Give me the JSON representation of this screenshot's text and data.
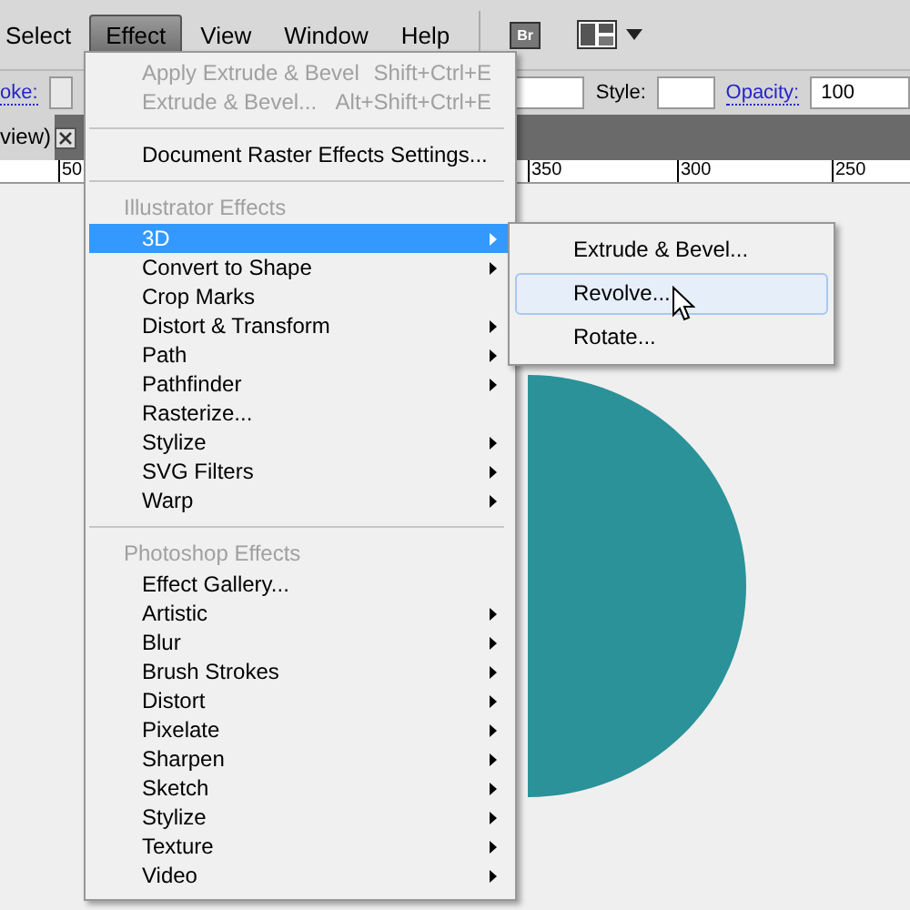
{
  "menubar": {
    "items": [
      {
        "label": "Select",
        "selected": false
      },
      {
        "label": "Effect",
        "selected": true
      },
      {
        "label": "View",
        "selected": false
      },
      {
        "label": "Window",
        "selected": false
      },
      {
        "label": "Help",
        "selected": false
      }
    ],
    "bridge_label": "Br"
  },
  "control_bar": {
    "stroke_label": "oke:",
    "style_label": "Style:",
    "opacity_label": "Opacity:",
    "opacity_value": "100"
  },
  "document_tab": {
    "title": "view)"
  },
  "ruler": {
    "labels": [
      "50",
      "350",
      "300",
      "250"
    ]
  },
  "menu": {
    "items": [
      {
        "kind": "item",
        "label": "Apply Extrude & Bevel",
        "shortcut": "Shift+Ctrl+E",
        "disabled": true,
        "submenu": false,
        "selected": false
      },
      {
        "kind": "item",
        "label": "Extrude & Bevel...",
        "shortcut": "Alt+Shift+Ctrl+E",
        "disabled": true,
        "submenu": false,
        "selected": false
      },
      {
        "kind": "separator"
      },
      {
        "kind": "item",
        "label": "Document Raster Effects Settings...",
        "disabled": false,
        "submenu": false,
        "selected": false
      },
      {
        "kind": "separator"
      },
      {
        "kind": "header",
        "label": "Illustrator Effects"
      },
      {
        "kind": "item",
        "label": "3D",
        "disabled": false,
        "submenu": true,
        "selected": true
      },
      {
        "kind": "item",
        "label": "Convert to Shape",
        "disabled": false,
        "submenu": true,
        "selected": false
      },
      {
        "kind": "item",
        "label": "Crop Marks",
        "disabled": false,
        "submenu": false,
        "selected": false
      },
      {
        "kind": "item",
        "label": "Distort & Transform",
        "disabled": false,
        "submenu": true,
        "selected": false
      },
      {
        "kind": "item",
        "label": "Path",
        "disabled": false,
        "submenu": true,
        "selected": false
      },
      {
        "kind": "item",
        "label": "Pathfinder",
        "disabled": false,
        "submenu": true,
        "selected": false
      },
      {
        "kind": "item",
        "label": "Rasterize...",
        "disabled": false,
        "submenu": false,
        "selected": false
      },
      {
        "kind": "item",
        "label": "Stylize",
        "disabled": false,
        "submenu": true,
        "selected": false
      },
      {
        "kind": "item",
        "label": "SVG Filters",
        "disabled": false,
        "submenu": true,
        "selected": false
      },
      {
        "kind": "item",
        "label": "Warp",
        "disabled": false,
        "submenu": true,
        "selected": false
      },
      {
        "kind": "separator"
      },
      {
        "kind": "header",
        "label": "Photoshop Effects"
      },
      {
        "kind": "item",
        "label": "Effect Gallery...",
        "disabled": false,
        "submenu": false,
        "selected": false
      },
      {
        "kind": "item",
        "label": "Artistic",
        "disabled": false,
        "submenu": true,
        "selected": false
      },
      {
        "kind": "item",
        "label": "Blur",
        "disabled": false,
        "submenu": true,
        "selected": false
      },
      {
        "kind": "item",
        "label": "Brush Strokes",
        "disabled": false,
        "submenu": true,
        "selected": false
      },
      {
        "kind": "item",
        "label": "Distort",
        "disabled": false,
        "submenu": true,
        "selected": false
      },
      {
        "kind": "item",
        "label": "Pixelate",
        "disabled": false,
        "submenu": true,
        "selected": false
      },
      {
        "kind": "item",
        "label": "Sharpen",
        "disabled": false,
        "submenu": true,
        "selected": false
      },
      {
        "kind": "item",
        "label": "Sketch",
        "disabled": false,
        "submenu": true,
        "selected": false
      },
      {
        "kind": "item",
        "label": "Stylize",
        "disabled": false,
        "submenu": true,
        "selected": false
      },
      {
        "kind": "item",
        "label": "Texture",
        "disabled": false,
        "submenu": true,
        "selected": false
      },
      {
        "kind": "item",
        "label": "Video",
        "disabled": false,
        "submenu": true,
        "selected": false
      }
    ]
  },
  "submenu": {
    "items": [
      {
        "label": "Extrude & Bevel...",
        "selected": false
      },
      {
        "label": "Revolve...",
        "selected": true
      },
      {
        "label": "Rotate...",
        "selected": false
      }
    ]
  }
}
